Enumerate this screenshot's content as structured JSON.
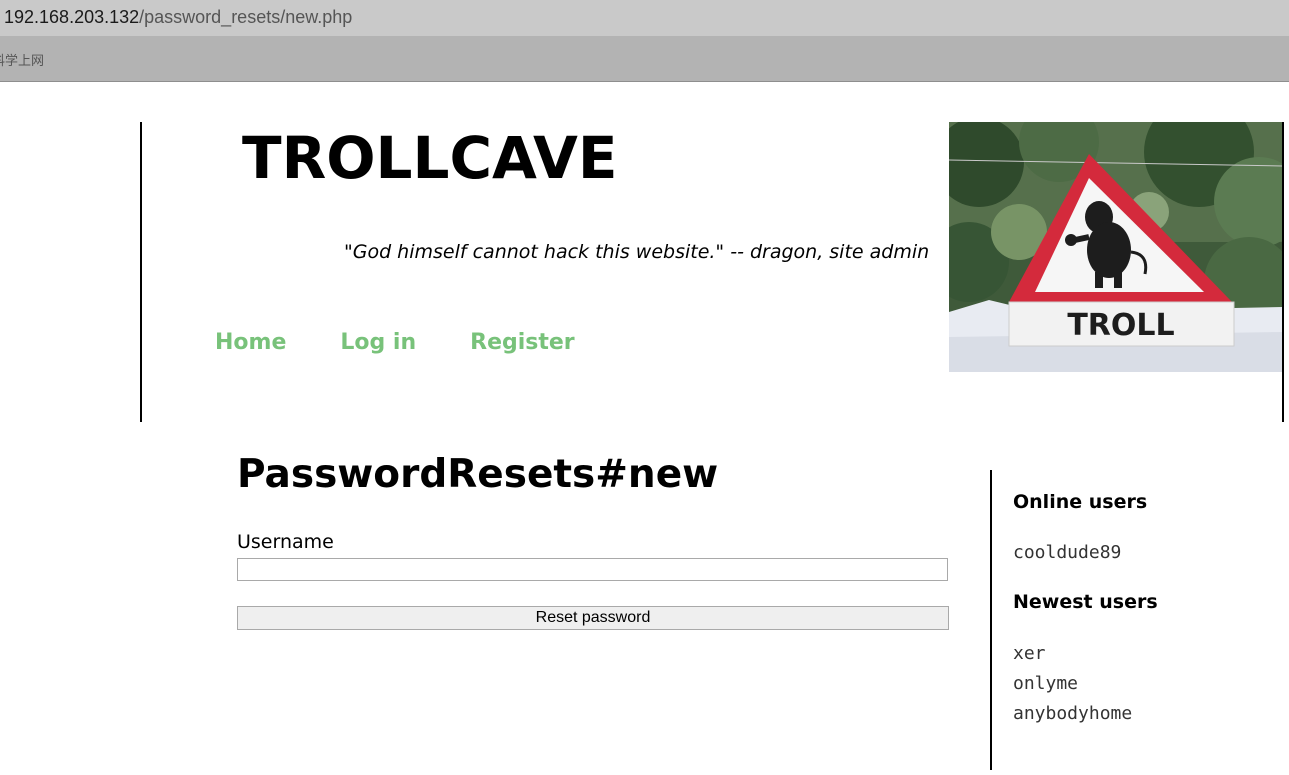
{
  "browser": {
    "address_host": "192.168.203.132",
    "address_path": "/password_resets/new.php",
    "bookmark_label": "科学上网"
  },
  "header": {
    "title": "TROLLCAVE",
    "tagline": "\"God himself cannot hack this website.\" -- dragon, site admin",
    "nav": [
      {
        "label": "Home"
      },
      {
        "label": "Log in"
      },
      {
        "label": "Register"
      }
    ],
    "image_sign_text": "TROLL"
  },
  "main": {
    "heading": "PasswordResets#new",
    "username_label": "Username",
    "username_value": "",
    "submit_label": "Reset password"
  },
  "sidebar": {
    "online_heading": "Online users",
    "online_users": [
      "cooldude89"
    ],
    "newest_heading": "Newest users",
    "newest_users": [
      "xer",
      "onlyme",
      "anybodyhome"
    ]
  },
  "colors": {
    "nav_link": "#78c27a",
    "address_bar": "#c9c9c9",
    "bookmarks_bar": "#b3b3b3",
    "sign_red": "#d42a3c"
  }
}
